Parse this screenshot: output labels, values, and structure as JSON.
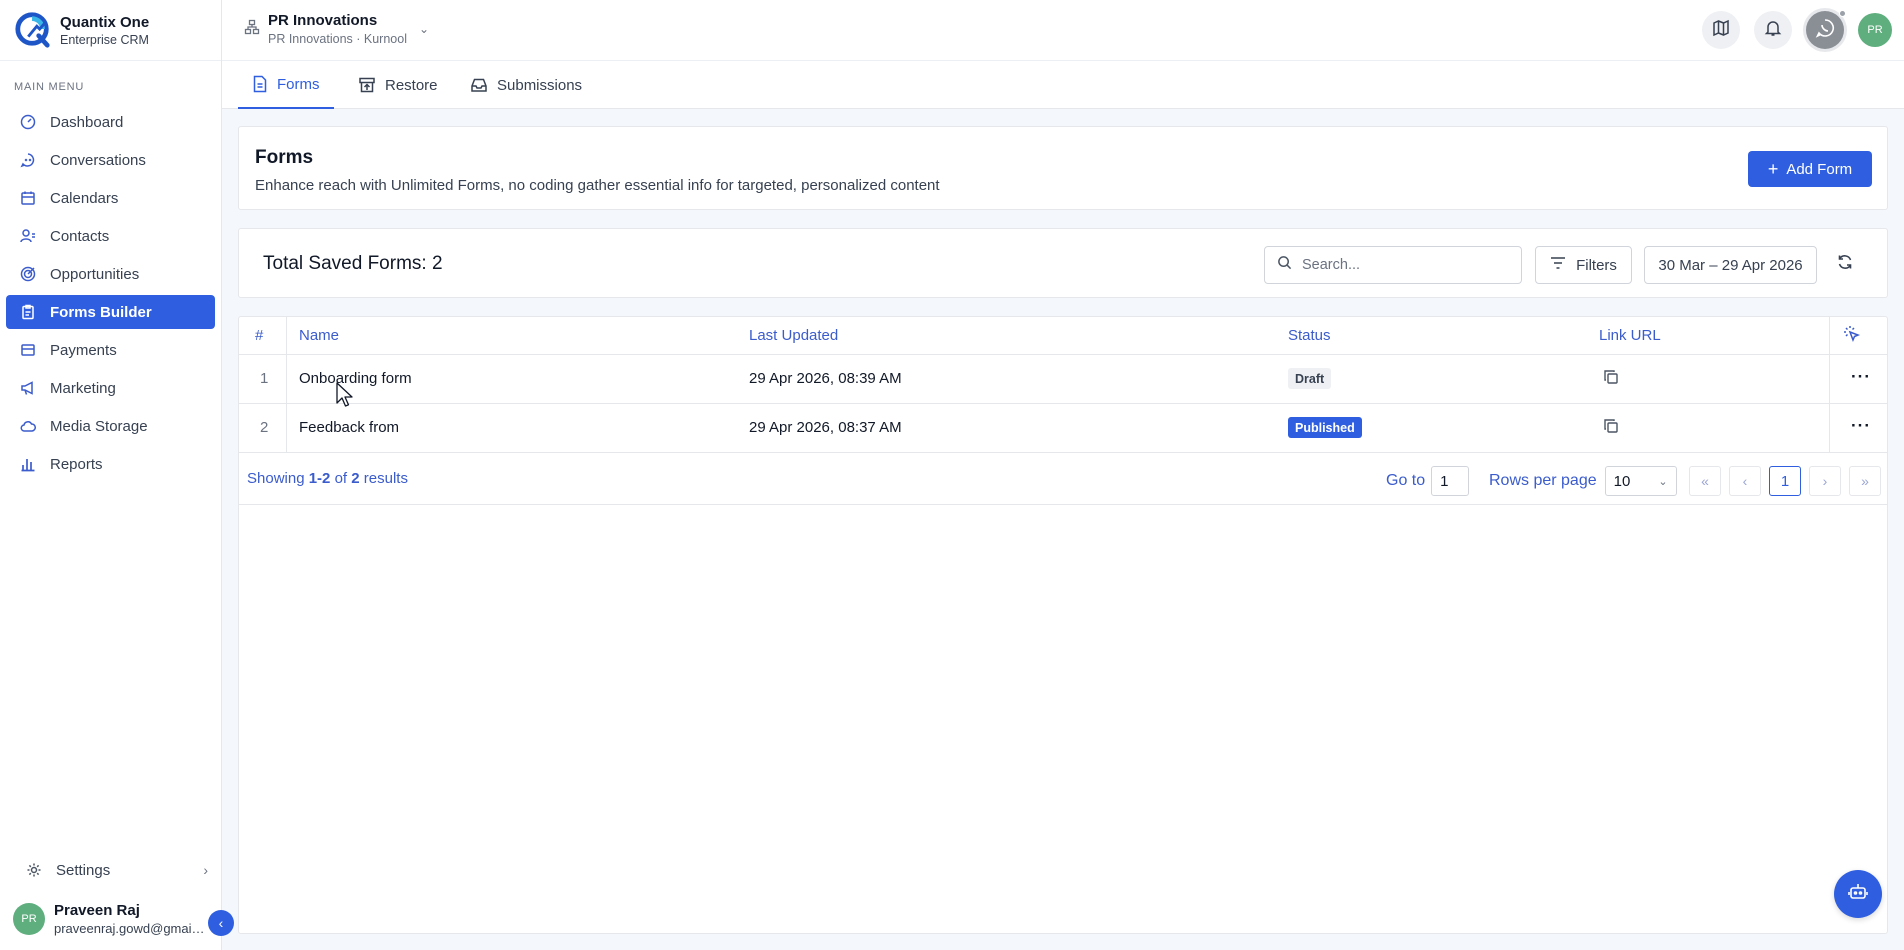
{
  "brand": {
    "name": "Quantix One",
    "subtitle": "Enterprise CRM"
  },
  "sidebar": {
    "heading": "MAIN MENU",
    "items": [
      {
        "label": "Dashboard",
        "icon": "gauge-icon",
        "active": false
      },
      {
        "label": "Conversations",
        "icon": "chat-icon",
        "active": false
      },
      {
        "label": "Calendars",
        "icon": "calendar-icon",
        "active": false
      },
      {
        "label": "Contacts",
        "icon": "contacts-icon",
        "active": false
      },
      {
        "label": "Opportunities",
        "icon": "target-icon",
        "active": false
      },
      {
        "label": "Forms Builder",
        "icon": "clipboard-icon",
        "active": true
      },
      {
        "label": "Payments",
        "icon": "wallet-icon",
        "active": false
      },
      {
        "label": "Marketing",
        "icon": "megaphone-icon",
        "active": false
      },
      {
        "label": "Media Storage",
        "icon": "cloud-icon",
        "active": false
      },
      {
        "label": "Reports",
        "icon": "bar-chart-icon",
        "active": false
      }
    ],
    "settings_label": "Settings"
  },
  "user": {
    "name": "Praveen Raj",
    "email": "praveenraj.gowd@gmail.com",
    "initials": "PR"
  },
  "topbar": {
    "org_name": "PR Innovations",
    "org_sub": "PR Innovations · Kurnool",
    "avatar_initials": "PR"
  },
  "tabs": [
    {
      "label": "Forms",
      "active": true
    },
    {
      "label": "Restore",
      "active": false
    },
    {
      "label": "Submissions",
      "active": false
    }
  ],
  "hero": {
    "title": "Forms",
    "description": "Enhance reach with Unlimited Forms, no coding gather essential info for targeted, personalized content",
    "add_button": "Add Form"
  },
  "toolbar": {
    "total_label": "Total Saved Forms: 2",
    "search_placeholder": "Search...",
    "filters_label": "Filters",
    "date_range": "30 Mar – 29 Apr 2026"
  },
  "table": {
    "columns": {
      "num": "#",
      "name": "Name",
      "updated": "Last Updated",
      "status": "Status",
      "link": "Link URL"
    },
    "rows": [
      {
        "num": "1",
        "name": "Onboarding form",
        "updated": "29 Apr 2026, 08:39 AM",
        "status": "Draft",
        "status_type": "draft"
      },
      {
        "num": "2",
        "name": "Feedback from",
        "updated": "29 Apr 2026, 08:37 AM",
        "status": "Published",
        "status_type": "published"
      }
    ]
  },
  "pagination": {
    "showing_prefix": "Showing ",
    "range": "1-2",
    "of": " of ",
    "total": "2",
    "suffix": " results",
    "goto_label": "Go to",
    "goto_value": "1",
    "rows_per_page_label": "Rows per page",
    "rows_per_page": "10",
    "current_page": "1"
  },
  "colors": {
    "accent": "#2f5fe0",
    "avatar": "#5fae7e",
    "link_text": "#3b5ccc"
  }
}
